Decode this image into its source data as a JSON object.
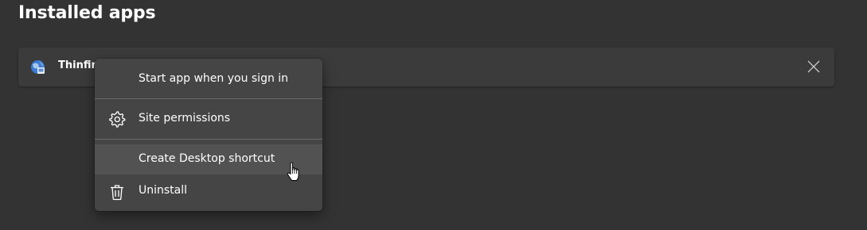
{
  "page": {
    "title": "Installed apps"
  },
  "app_card": {
    "name": "Thinfin",
    "icon": "thinfinity-app-icon",
    "close_icon": "close-icon"
  },
  "context_menu": {
    "items": [
      {
        "label": "Start app when you sign in",
        "icon": ""
      },
      {
        "label": "Site permissions",
        "icon": "gear-icon"
      },
      {
        "label": "Create Desktop shortcut",
        "icon": "",
        "hovered": true
      },
      {
        "label": "Uninstall",
        "icon": "trash-icon"
      }
    ]
  },
  "colors": {
    "background": "#333333",
    "card": "#3b3b3b",
    "menu": "#454545",
    "menu_hover": "#525252",
    "text": "#ffffff"
  }
}
